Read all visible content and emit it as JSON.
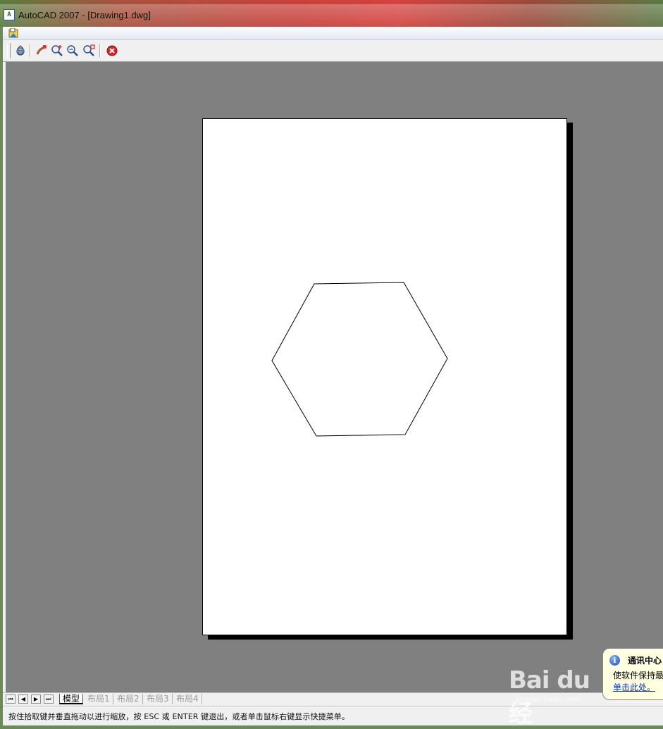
{
  "window": {
    "title": "AutoCAD 2007 - [Drawing1.dwg]",
    "app_icon_label": "A"
  },
  "toolbar": {
    "buttons": [
      {
        "name": "pan-icon"
      },
      {
        "name": "zoom-realtime-icon"
      },
      {
        "name": "zoom-window-icon"
      },
      {
        "name": "zoom-previous-icon"
      },
      {
        "name": "zoom-extents-icon"
      },
      {
        "name": "close-preview-icon"
      }
    ]
  },
  "tabs": {
    "nav": [
      "⏮",
      "◀",
      "▶",
      "⏭"
    ],
    "items": [
      {
        "label": "模型",
        "active": true
      },
      {
        "label": "布局1",
        "active": false
      },
      {
        "label": "布局2",
        "active": false
      },
      {
        "label": "布局3",
        "active": false
      },
      {
        "label": "布局4",
        "active": false
      }
    ]
  },
  "status": {
    "text": "按住拾取键并垂直拖动以进行缩放，按 ESC 或 ENTER 键退出，或者单击鼠标右键显示快捷菜单。"
  },
  "balloon": {
    "title": "通讯中心",
    "body": "使软件保持最",
    "link": "单击此处。"
  },
  "watermark": {
    "text": "Bai du 经",
    "sub": "jingyan.baidu.com"
  },
  "colors": {
    "viewport": "#808080",
    "paper": "#ffffff",
    "close_red": "#d9232a"
  }
}
